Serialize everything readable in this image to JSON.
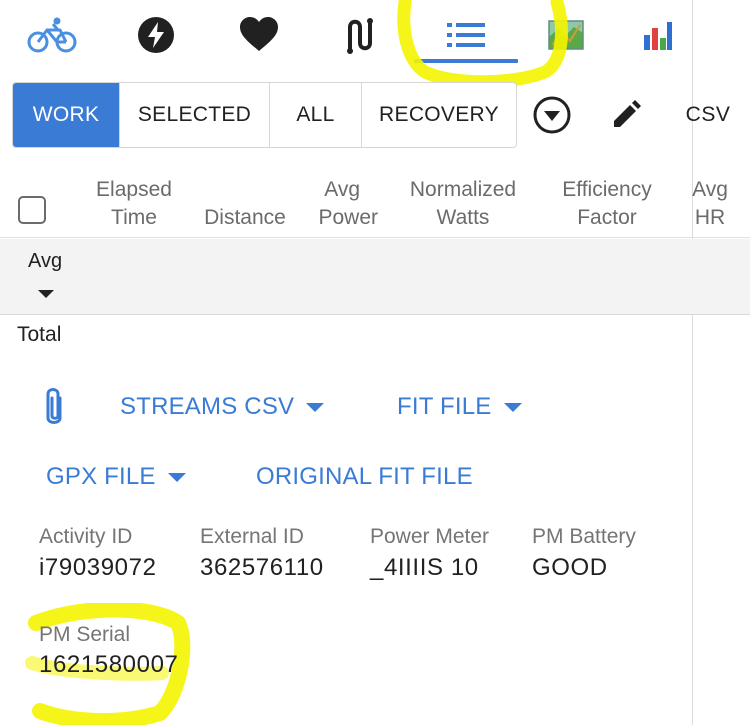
{
  "tabs": [
    {
      "name": "bicycle-icon",
      "color": "#4a90e2"
    },
    {
      "name": "lightning-icon",
      "color": "#212121"
    },
    {
      "name": "heart-icon",
      "color": "#212121"
    },
    {
      "name": "route-icon",
      "color": "#212121"
    },
    {
      "name": "list-icon",
      "color": "#3a7bd5",
      "active": true
    },
    {
      "name": "map-icon",
      "color": "#5aa84a"
    },
    {
      "name": "bar-chart-icon",
      "color": "#2f6fd1"
    }
  ],
  "filters": [
    {
      "label": "WORK",
      "active": true
    },
    {
      "label": "SELECTED"
    },
    {
      "label": "ALL"
    },
    {
      "label": "RECOVERY"
    }
  ],
  "toolbar": {
    "dropdown_icon": "circle-chevron-down-icon",
    "edit_icon": "pencil-icon",
    "csv_label": "CSV"
  },
  "table": {
    "columns": [
      {
        "line1": "Elapsed",
        "line2": "Time"
      },
      {
        "line1": "",
        "line2": "Distance"
      },
      {
        "line1": "Avg",
        "line2": "Power"
      },
      {
        "line1": "Normalized",
        "line2": "Watts"
      },
      {
        "line1": "Efficiency",
        "line2": "Factor"
      },
      {
        "line1": "Avg",
        "line2": "HR"
      }
    ],
    "avg_label": "Avg",
    "total_label": "Total"
  },
  "downloads": {
    "streams_csv": "STREAMS CSV",
    "fit_file": "FIT FILE",
    "gpx_file": "GPX FILE",
    "original_fit_file": "ORIGINAL FIT FILE"
  },
  "details": [
    {
      "label": "Activity ID",
      "value": "i79039072"
    },
    {
      "label": "External ID",
      "value": "362576110"
    },
    {
      "label": "Power Meter",
      "value": "_4IIIIS 10"
    },
    {
      "label": "PM Battery",
      "value": "GOOD"
    },
    {
      "label": "PM Serial",
      "value": "1621580007"
    }
  ],
  "colors": {
    "accent": "#3a7bd5",
    "highlighter": "#f4f400"
  }
}
